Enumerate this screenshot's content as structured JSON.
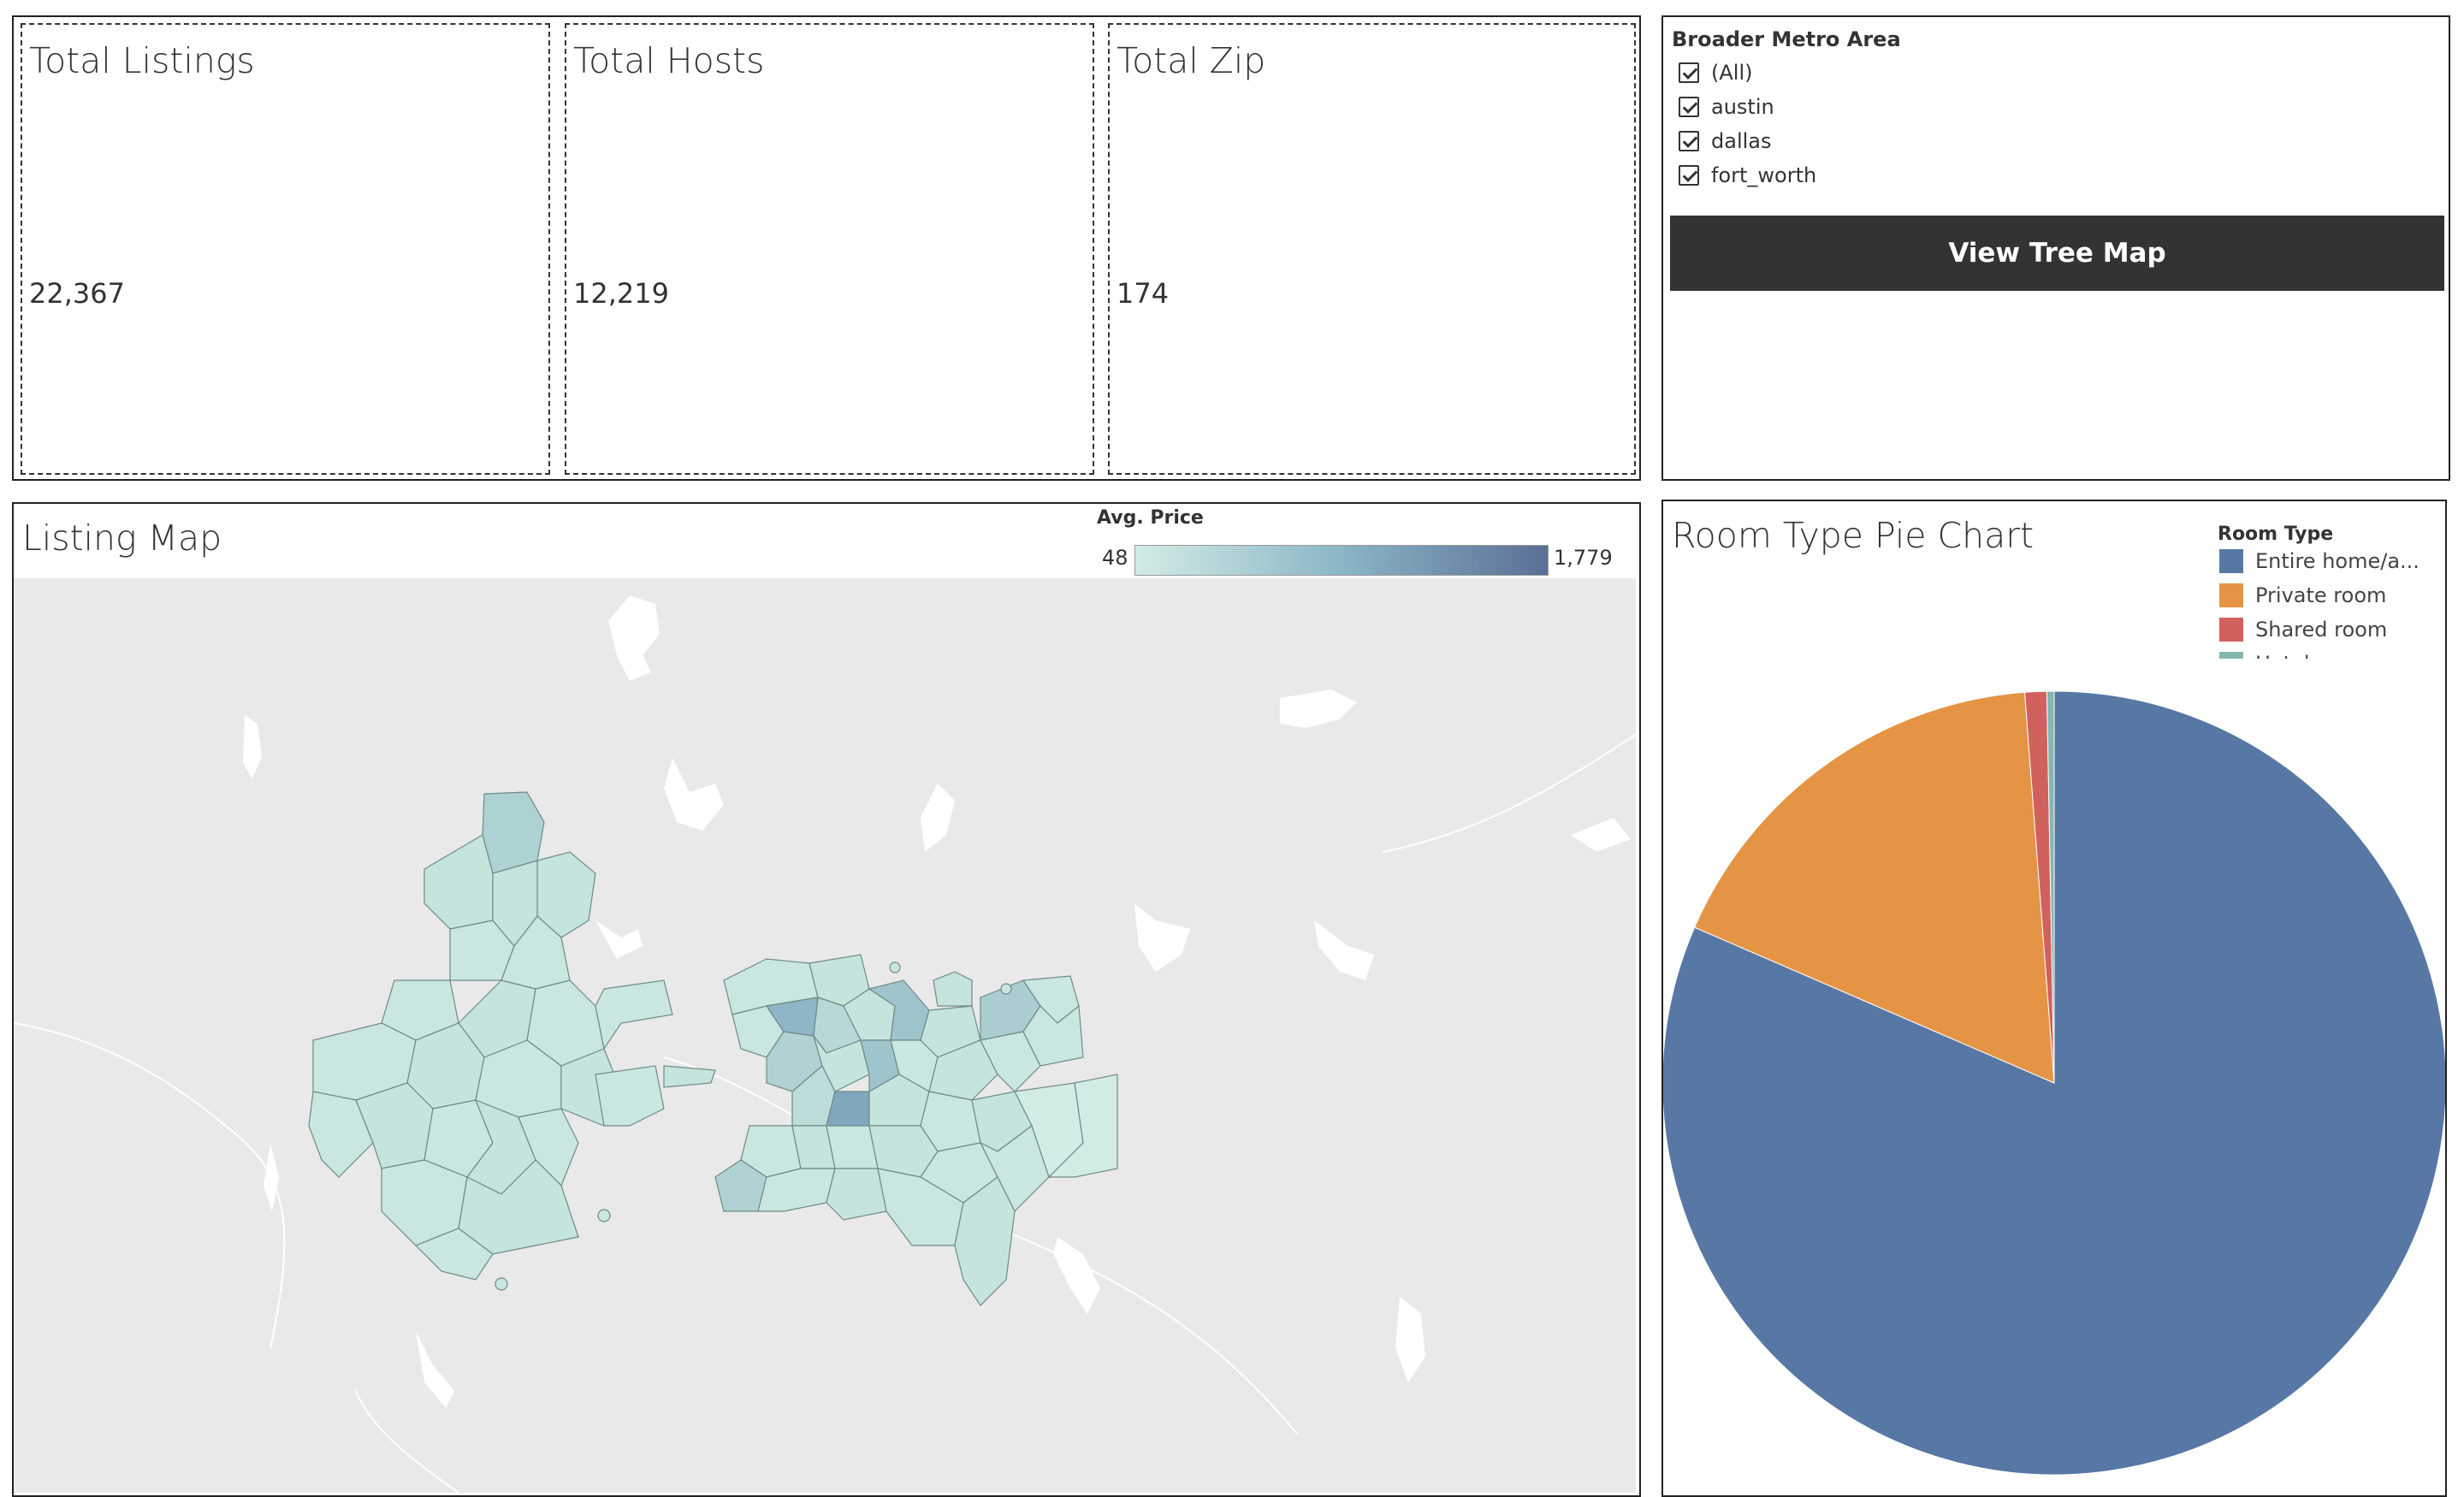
{
  "kpis": {
    "listings": {
      "title": "Total Listings",
      "value": "22,367"
    },
    "hosts": {
      "title": "Total Hosts",
      "value": "12,219"
    },
    "zip": {
      "title": "Total Zip",
      "value": "174"
    }
  },
  "filter": {
    "title": "Broader Metro Area",
    "options": [
      {
        "label": "(All)",
        "checked": true
      },
      {
        "label": "austin",
        "checked": true
      },
      {
        "label": "dallas",
        "checked": true
      },
      {
        "label": "fort_worth",
        "checked": true
      }
    ],
    "button_label": "View Tree Map"
  },
  "map": {
    "title": "Listing Map",
    "legend_title": "Avg. Price",
    "legend_min": "48",
    "legend_max": "1,779",
    "ramp_colors": [
      "#d3ebe5",
      "#8ab6c6",
      "#5b6f96"
    ]
  },
  "pie": {
    "title": "Room Type Pie Chart",
    "legend_title": "Room Type",
    "legend_items": [
      {
        "label": "Entire home/a...",
        "color": "#5778a4"
      },
      {
        "label": "Private room",
        "color": "#e49444"
      },
      {
        "label": "Shared room",
        "color": "#d1615d"
      },
      {
        "label": "Hotel room",
        "color": "#85b6b2"
      }
    ]
  },
  "chart_data": {
    "type": "pie",
    "title": "Room Type Pie Chart",
    "categories": [
      "Entire home/a...",
      "Private room",
      "Shared room",
      "Hotel room"
    ],
    "values": [
      81.5,
      17.3,
      0.9,
      0.3
    ],
    "colors": [
      "#5778a4",
      "#e49444",
      "#d1615d",
      "#85b6b2"
    ],
    "legend": "top-right"
  }
}
